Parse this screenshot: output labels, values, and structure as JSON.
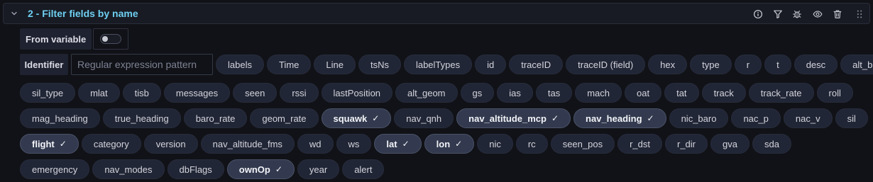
{
  "header": {
    "title": "2 - Filter fields by name",
    "icons": [
      "info-icon",
      "filter-icon",
      "debug-icon",
      "eye-icon",
      "trash-icon",
      "drag-handle-icon"
    ]
  },
  "from_variable": {
    "label": "From variable",
    "enabled": false
  },
  "identifier": {
    "label": "Identifier",
    "placeholder": "Regular expression pattern",
    "value": ""
  },
  "check_mark": "✓",
  "fields": [
    {
      "name": "labels",
      "selected": false
    },
    {
      "name": "Time",
      "selected": false
    },
    {
      "name": "Line",
      "selected": false
    },
    {
      "name": "tsNs",
      "selected": false
    },
    {
      "name": "labelTypes",
      "selected": false
    },
    {
      "name": "id",
      "selected": false
    },
    {
      "name": "traceID",
      "selected": false
    },
    {
      "name": "traceID (field)",
      "selected": false
    },
    {
      "name": "hex",
      "selected": false
    },
    {
      "name": "type",
      "selected": false
    },
    {
      "name": "r",
      "selected": false
    },
    {
      "name": "t",
      "selected": false
    },
    {
      "name": "desc",
      "selected": false
    },
    {
      "name": "alt_baro",
      "selected": false
    },
    {
      "name": "sil_type",
      "selected": false
    },
    {
      "name": "mlat",
      "selected": false
    },
    {
      "name": "tisb",
      "selected": false
    },
    {
      "name": "messages",
      "selected": false
    },
    {
      "name": "seen",
      "selected": false
    },
    {
      "name": "rssi",
      "selected": false
    },
    {
      "name": "lastPosition",
      "selected": false
    },
    {
      "name": "alt_geom",
      "selected": false
    },
    {
      "name": "gs",
      "selected": false
    },
    {
      "name": "ias",
      "selected": false
    },
    {
      "name": "tas",
      "selected": false
    },
    {
      "name": "mach",
      "selected": false
    },
    {
      "name": "oat",
      "selected": false
    },
    {
      "name": "tat",
      "selected": false
    },
    {
      "name": "track",
      "selected": false
    },
    {
      "name": "track_rate",
      "selected": false
    },
    {
      "name": "roll",
      "selected": false
    },
    {
      "name": "mag_heading",
      "selected": false
    },
    {
      "name": "true_heading",
      "selected": false
    },
    {
      "name": "baro_rate",
      "selected": false
    },
    {
      "name": "geom_rate",
      "selected": false
    },
    {
      "name": "squawk",
      "selected": true
    },
    {
      "name": "nav_qnh",
      "selected": false
    },
    {
      "name": "nav_altitude_mcp",
      "selected": true
    },
    {
      "name": "nav_heading",
      "selected": true
    },
    {
      "name": "nic_baro",
      "selected": false
    },
    {
      "name": "nac_p",
      "selected": false
    },
    {
      "name": "nac_v",
      "selected": false
    },
    {
      "name": "sil",
      "selected": false
    },
    {
      "name": "flight",
      "selected": true
    },
    {
      "name": "category",
      "selected": false
    },
    {
      "name": "version",
      "selected": false
    },
    {
      "name": "nav_altitude_fms",
      "selected": false
    },
    {
      "name": "wd",
      "selected": false
    },
    {
      "name": "ws",
      "selected": false
    },
    {
      "name": "lat",
      "selected": true
    },
    {
      "name": "lon",
      "selected": true
    },
    {
      "name": "nic",
      "selected": false
    },
    {
      "name": "rc",
      "selected": false
    },
    {
      "name": "seen_pos",
      "selected": false
    },
    {
      "name": "r_dst",
      "selected": false
    },
    {
      "name": "r_dir",
      "selected": false
    },
    {
      "name": "gva",
      "selected": false
    },
    {
      "name": "sda",
      "selected": false
    },
    {
      "name": "emergency",
      "selected": false
    },
    {
      "name": "nav_modes",
      "selected": false
    },
    {
      "name": "dbFlags",
      "selected": false
    },
    {
      "name": "ownOp",
      "selected": true
    },
    {
      "name": "year",
      "selected": false
    },
    {
      "name": "alert",
      "selected": false
    }
  ],
  "colors": {
    "title": "#6ecff2",
    "chip_bg": "#212636",
    "chip_selected_bg": "#333a4f",
    "panel_bg": "#111217"
  }
}
